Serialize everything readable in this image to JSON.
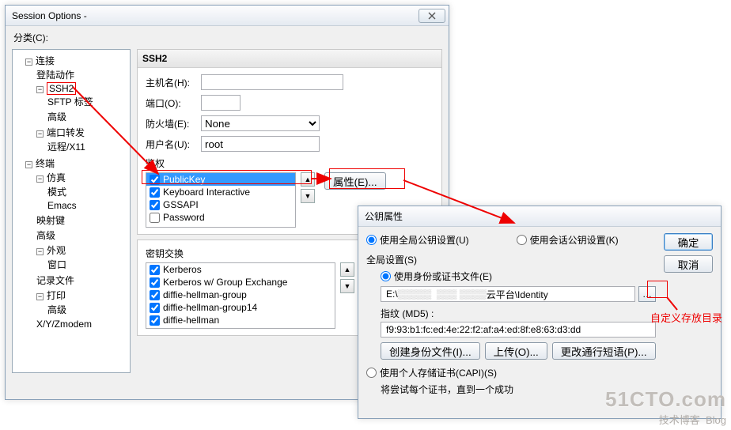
{
  "main_window": {
    "title": "Session Options -",
    "category_label": "分类(C):",
    "tree": {
      "conn": "连接",
      "login": "登陆动作",
      "ssh2": "SSH2",
      "sftp": "SFTP 标签",
      "advanced_ssh": "高级",
      "portfwd": "端口转发",
      "remote_x11": "远程/X11",
      "terminal": "终端",
      "emu": "仿真",
      "mode": "模式",
      "emacs": "Emacs",
      "map": "映射键",
      "advanced_term": "高级",
      "appearance": "外观",
      "window": "窗口",
      "log": "记录文件",
      "print": "打印",
      "advanced_print": "高级",
      "xyz": "X/Y/Zmodem"
    },
    "ssh2_header": "SSH2",
    "labels": {
      "host": "主机名(H):",
      "port": "端口(O):",
      "firewall": "防火墙(E):",
      "username": "用户名(U):",
      "auth": "鉴权",
      "props": "属性(E)...",
      "kex": "密钥交换",
      "ok": "确定"
    },
    "values": {
      "host": "",
      "port": "",
      "firewall": "None",
      "username": "root"
    },
    "auth_methods": [
      {
        "label": "PublicKey",
        "checked": true,
        "selected": true
      },
      {
        "label": "Keyboard Interactive",
        "checked": true,
        "selected": false
      },
      {
        "label": "GSSAPI",
        "checked": true,
        "selected": false
      },
      {
        "label": "Password",
        "checked": false,
        "selected": false
      }
    ],
    "kex_methods": [
      {
        "label": "Kerberos",
        "checked": true
      },
      {
        "label": "Kerberos w/ Group Exchange",
        "checked": true
      },
      {
        "label": "diffie-hellman-group",
        "checked": true
      },
      {
        "label": "diffie-hellman-group14",
        "checked": true
      },
      {
        "label": "diffie-hellman",
        "checked": true
      }
    ]
  },
  "pk_window": {
    "title": "公钥属性",
    "use_global": "使用全局公钥设置(U)",
    "use_session": "使用会话公钥设置(K)",
    "global_settings": "全局设置(S)",
    "use_identity": "使用身份或证书文件(E)",
    "identity_prefix": "E:\\",
    "identity_suffix": "云平台\\Identity",
    "fingerprint_label": "指纹 (MD5) :",
    "fingerprint": "f9:93:b1:fc:ed:4e:22:f2:af:a4:ed:8f:e8:63:d3:dd",
    "btn_create": "创建身份文件(I)...",
    "btn_upload": "上传(O)...",
    "btn_passphrase": "更改通行短语(P)...",
    "use_capi": "使用个人存储证书(CAPI)(S)",
    "capi_note": "将尝试每个证书，直到一个成功",
    "ok": "确定",
    "cancel": "取消"
  },
  "annotation": "自定义存放目录",
  "watermark": {
    "big": "51CTO.com",
    "sub": "技术博客",
    "tag": "Blog"
  }
}
